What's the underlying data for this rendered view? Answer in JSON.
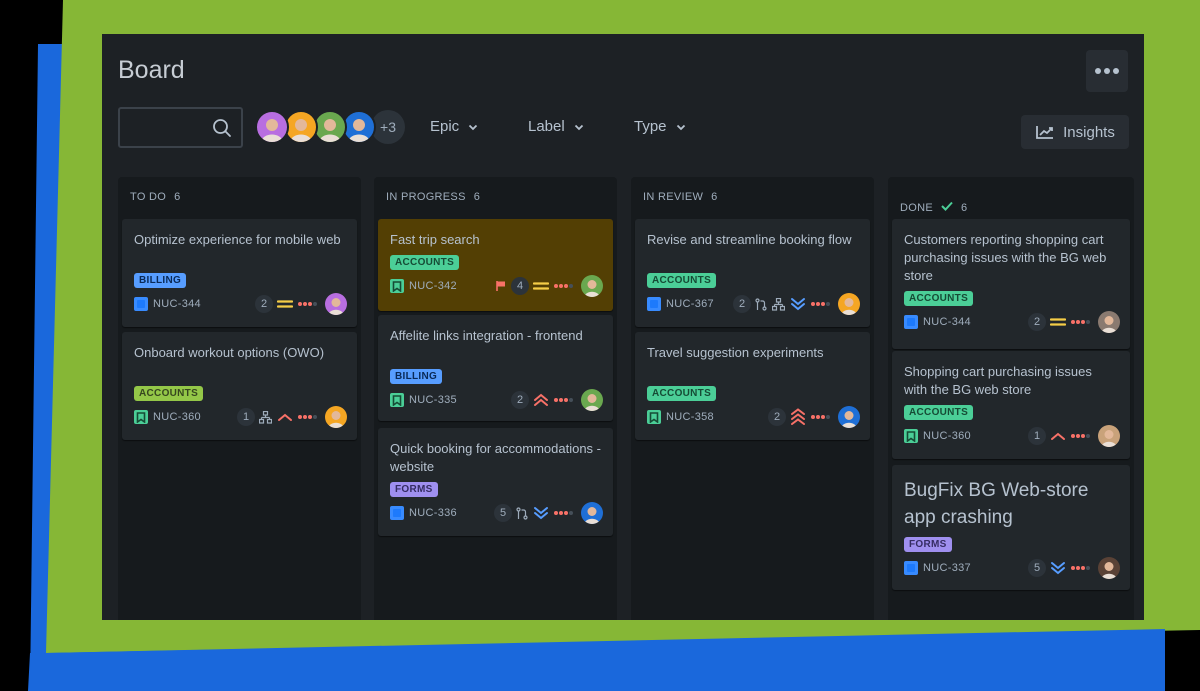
{
  "board": {
    "title": "Board",
    "more_label": "More actions",
    "search": {
      "value": "",
      "placeholder": ""
    },
    "avatars": [
      {
        "name": "user-1",
        "color": "#b86ee0"
      },
      {
        "name": "user-2",
        "color": "#f5a623"
      },
      {
        "name": "user-3",
        "color": "#6aa84f"
      },
      {
        "name": "user-4",
        "color": "#1f6fd6"
      }
    ],
    "avatars_more": "+3",
    "filters": [
      {
        "label": "Epic"
      },
      {
        "label": "Label"
      },
      {
        "label": "Type"
      }
    ],
    "insights_label": "Insights"
  },
  "columns": [
    {
      "title": "TO DO",
      "count": "6",
      "done": false,
      "cards": [
        {
          "title": "Optimize experience for mobile web",
          "label": "BILLING",
          "label_style": "billing",
          "type": "task",
          "key": "NUC-344",
          "count": "2",
          "icons": [
            "priority-medium"
          ],
          "avatar": "#b86ee0"
        },
        {
          "title": "Onboard workout options (OWO)",
          "label": "ACCOUNTS",
          "label_style": "accounts-lime",
          "type": "story",
          "key": "NUC-360",
          "count": "1",
          "icons": [
            "child-issues",
            "priority-high"
          ],
          "avatar": "#f5a623"
        }
      ]
    },
    {
      "title": "IN PROGRESS",
      "count": "6",
      "done": false,
      "cards": [
        {
          "title": "Fast trip search",
          "label": "ACCOUNTS",
          "label_style": "accounts",
          "type": "story",
          "key": "NUC-342",
          "count": "4",
          "flagged": true,
          "icons": [
            "priority-medium"
          ],
          "avatar": "#6aa84f",
          "highlight": true
        },
        {
          "title": "Affelite links integration - frontend",
          "label": "BILLING",
          "label_style": "billing",
          "type": "story",
          "key": "NUC-335",
          "count": "2",
          "icons": [
            "priority-highest"
          ],
          "avatar": "#6aa84f"
        },
        {
          "title": "Quick booking for accommodations - website",
          "label": "FORMS",
          "label_style": "forms",
          "type": "task",
          "key": "NUC-336",
          "count": "5",
          "icons": [
            "pull-request",
            "priority-lowest"
          ],
          "avatar": "#1f6fd6"
        }
      ]
    },
    {
      "title": "IN REVIEW",
      "count": "6",
      "done": false,
      "cards": [
        {
          "title": "Revise and streamline booking flow",
          "label": "ACCOUNTS",
          "label_style": "accounts",
          "type": "task",
          "key": "NUC-367",
          "count": "2",
          "icons": [
            "pull-request",
            "child-issues",
            "priority-lowest"
          ],
          "avatar": "#f5a623"
        },
        {
          "title": "Travel suggestion experiments",
          "label": "ACCOUNTS",
          "label_style": "accounts",
          "type": "story",
          "key": "NUC-358",
          "count": "2",
          "icons": [
            "priority-critical"
          ],
          "avatar": "#1f6fd6"
        }
      ]
    },
    {
      "title": "DONE",
      "count": "6",
      "done": true,
      "cards": [
        {
          "title": "Customers reporting shopping cart purchasing issues with the BG web store",
          "label": "ACCOUNTS",
          "label_style": "accounts",
          "type": "task",
          "key": "NUC-344",
          "count": "2",
          "icons": [
            "priority-medium"
          ],
          "avatar": "#8a7a70"
        },
        {
          "title": "Shopping cart purchasing issues with the BG web store",
          "label": "ACCOUNTS",
          "label_style": "accounts",
          "type": "story",
          "key": "NUC-360",
          "count": "1",
          "icons": [
            "priority-high"
          ],
          "avatar": "#c9a27a"
        },
        {
          "title": "BugFix BG Web-store app crashing",
          "label": "FORMS",
          "label_style": "forms",
          "type": "task",
          "key": "NUC-337",
          "count": "5",
          "icons": [
            "priority-lowest"
          ],
          "avatar": "#5a4236",
          "big": true
        }
      ]
    }
  ],
  "colors": {
    "background_green": "#86b736",
    "background_blue": "#1a68dc",
    "board_bg": "#1d2125",
    "column_bg": "#161a1d",
    "card_bg": "#22272b",
    "card_highlight": "#533f04"
  }
}
